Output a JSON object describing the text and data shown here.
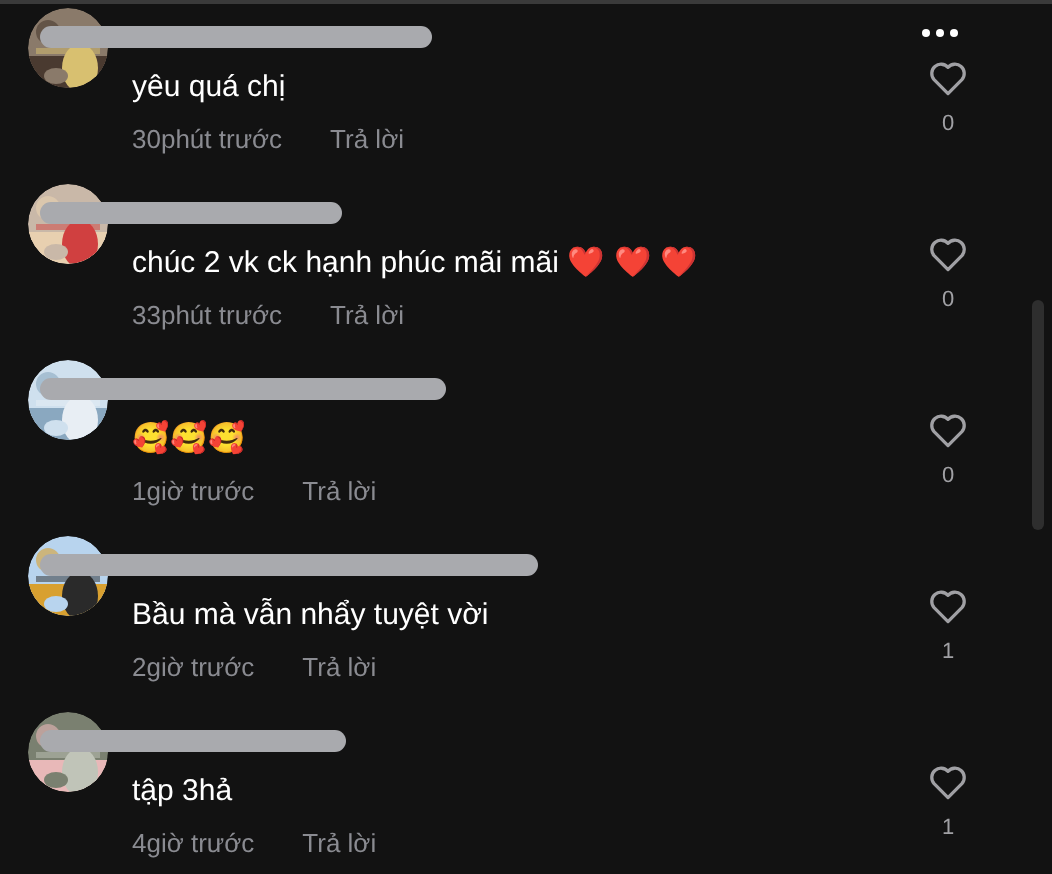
{
  "comments": [
    {
      "text": "yêu quá chị",
      "time": "30phút trước",
      "reply": "Trả lời",
      "likes": "0"
    },
    {
      "text": "chúc 2 vk ck hạnh phúc mãi mãi ❤️ ❤️ ❤️",
      "time": "33phút trước",
      "reply": "Trả lời",
      "likes": "0"
    },
    {
      "text": "🥰🥰🥰",
      "time": "1giờ trước",
      "reply": "Trả lời",
      "likes": "0"
    },
    {
      "text": "Bầu mà vẫn nhẩy tuyệt vời",
      "time": "2giờ trước",
      "reply": "Trả lời",
      "likes": "1"
    },
    {
      "text": "tập 3hả",
      "time": "4giờ trước",
      "reply": "Trả lời",
      "likes": "1"
    }
  ]
}
